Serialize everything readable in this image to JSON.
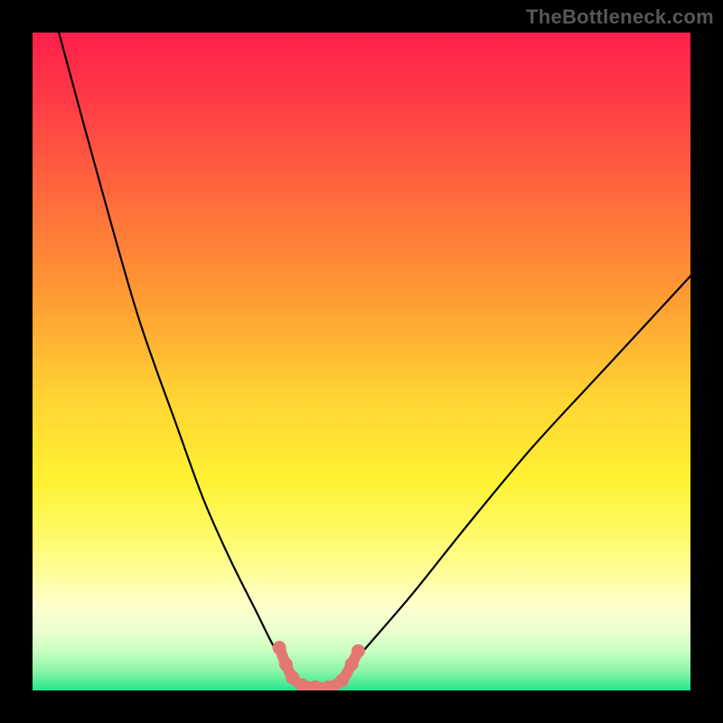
{
  "watermark": {
    "text": "TheBottleneck.com"
  },
  "chart_data": {
    "type": "line",
    "title": "",
    "xlabel": "",
    "ylabel": "",
    "xlim": [
      0,
      100
    ],
    "ylim": [
      0,
      100
    ],
    "grid": false,
    "legend": false,
    "background_gradient": {
      "orientation": "vertical",
      "stops": [
        {
          "pos": 0,
          "color": "#ff1f4a"
        },
        {
          "pos": 25,
          "color": "#ff6a3c"
        },
        {
          "pos": 55,
          "color": "#ffd233"
        },
        {
          "pos": 80,
          "color": "#fffd99"
        },
        {
          "pos": 97,
          "color": "#8cf5a8"
        },
        {
          "pos": 100,
          "color": "#28e68c"
        }
      ]
    },
    "series": [
      {
        "name": "left-branch",
        "style": "thin-black-line",
        "x": [
          4,
          10,
          16,
          22,
          26,
          30,
          34,
          36.5,
          38.5
        ],
        "y": [
          100,
          78,
          57,
          40,
          29,
          20,
          12,
          7,
          4
        ]
      },
      {
        "name": "right-branch",
        "style": "thin-black-line",
        "x": [
          48.5,
          52,
          58,
          66,
          76,
          88,
          100
        ],
        "y": [
          4,
          8,
          15,
          25,
          37,
          50,
          63
        ]
      },
      {
        "name": "valley-highlight",
        "style": "thick-salmon-line-with-markers",
        "color": "#e37873",
        "points": [
          {
            "x": 37.5,
            "y": 6.5
          },
          {
            "x": 38.5,
            "y": 4
          },
          {
            "x": 39.5,
            "y": 2
          },
          {
            "x": 41,
            "y": 0.8
          },
          {
            "x": 43,
            "y": 0.5
          },
          {
            "x": 45,
            "y": 0.5
          },
          {
            "x": 47,
            "y": 1.5
          },
          {
            "x": 48.5,
            "y": 4
          },
          {
            "x": 49.5,
            "y": 6
          }
        ]
      }
    ]
  }
}
